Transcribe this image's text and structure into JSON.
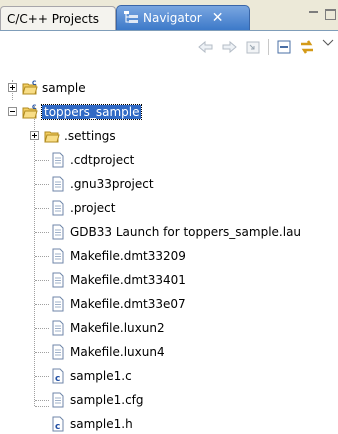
{
  "tabs": [
    {
      "label": "C/C++ Projects",
      "active": false
    },
    {
      "label": "Navigator",
      "active": true,
      "close_glyph": "✕"
    }
  ],
  "toolbar": {
    "buttons": [
      "back-arrow-icon",
      "forward-arrow-icon",
      "go-into-icon",
      "collapse-all-icon",
      "link-with-editor-icon",
      "view-menu-icon"
    ]
  },
  "tree": {
    "projects": [
      {
        "label": "sample",
        "expanded": false
      },
      {
        "label": "toppers_sample",
        "expanded": true,
        "selected": true
      }
    ],
    "children": [
      {
        "label": ".settings",
        "type": "folder"
      },
      {
        "label": ".cdtproject",
        "type": "file"
      },
      {
        "label": ".gnu33project",
        "type": "file"
      },
      {
        "label": ".project",
        "type": "file"
      },
      {
        "label": "GDB33 Launch for toppers_sample.lau",
        "type": "file"
      },
      {
        "label": "Makefile.dmt33209",
        "type": "file"
      },
      {
        "label": "Makefile.dmt33401",
        "type": "file"
      },
      {
        "label": "Makefile.dmt33e07",
        "type": "file"
      },
      {
        "label": "Makefile.luxun2",
        "type": "file"
      },
      {
        "label": "Makefile.luxun4",
        "type": "file"
      },
      {
        "label": "sample1.c",
        "type": "c-file"
      },
      {
        "label": "sample1.cfg",
        "type": "file"
      },
      {
        "label": "sample1.h",
        "type": "c-file"
      }
    ]
  },
  "colors": {
    "selection": "#316ac5",
    "active_tab": "#3c79c9",
    "folder": "#f0c850"
  }
}
